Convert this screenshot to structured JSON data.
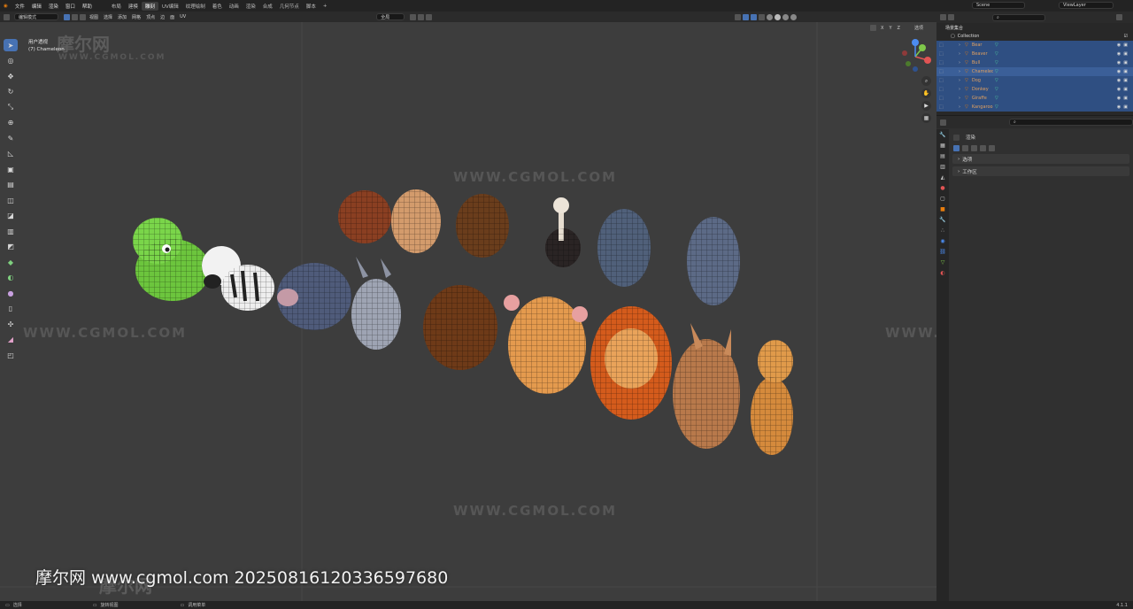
{
  "colors": {
    "accent": "#4772b3",
    "viewport_bg": "#3d3d3d",
    "object_orange": "#e0a060",
    "selected_row": "#2f4f82"
  },
  "menu": {
    "items": [
      "文件",
      "编辑",
      "渲染",
      "窗口",
      "帮助"
    ]
  },
  "workspaces": {
    "tabs": [
      "布局",
      "建模",
      "雕刻",
      "UV编辑",
      "纹理绘制",
      "着色",
      "动画",
      "渲染",
      "合成",
      "几何节点",
      "脚本"
    ],
    "active": "雕刻"
  },
  "scene": {
    "name": "Scene",
    "view_layer": "ViewLayer"
  },
  "viewport": {
    "mode": "编辑模式",
    "header_menus": [
      "视图",
      "选择",
      "添加",
      "网格",
      "顶点",
      "边",
      "面",
      "UV"
    ],
    "transform_space": "全局",
    "options_label": "选项",
    "view_name": "用户透视",
    "object_label": "(7) Chameleon",
    "axis_x": "X",
    "axis_y": "Y",
    "axis_z": "Z"
  },
  "tools": [
    "select-box",
    "cursor",
    "move",
    "rotate",
    "scale",
    "transform",
    "annotate",
    "measure",
    "add-cube",
    "extrude",
    "inset",
    "bevel",
    "loop-cut",
    "knife",
    "poly-build",
    "spin",
    "smooth",
    "edge-slide",
    "shrink-fatten",
    "shear",
    "rip"
  ],
  "outliner": {
    "title": "场景集合",
    "collection": "Collection",
    "search_placeholder": "",
    "objects": [
      "Bear",
      "Beaver",
      "Bull",
      "Chameleon",
      "Dog",
      "Donkey",
      "Giraffe",
      "Kangaroo"
    ],
    "active_object": "Chameleon"
  },
  "properties": {
    "search_placeholder": "",
    "section_title": "渲染",
    "panels": [
      "选项",
      "工作区"
    ]
  },
  "statusbar": {
    "left": "选择",
    "middle": "旋转视图",
    "right": "调用菜单",
    "version": "4.1.1"
  },
  "watermarks": {
    "brand_cn": "摩尔网",
    "url_caps": "WWW.CGMOL.COM"
  },
  "caption": "摩尔网 www.cgmol.com 20250816120336597680"
}
